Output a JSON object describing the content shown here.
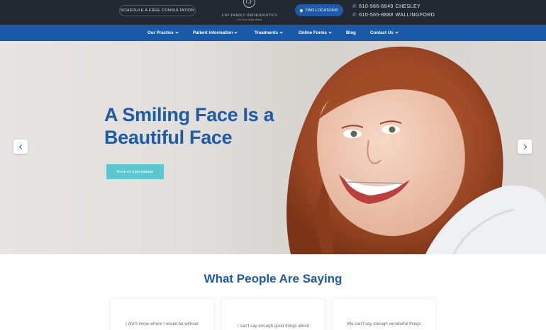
{
  "topbar": {
    "consult_label": "SCHEDULE A FREE CONSULTATION",
    "logo_mark": "CF",
    "logo_name": "CDF FAMILY ORTHODONTICS",
    "logo_tagline": "Let Your Smile Shine",
    "locations_label": "TWO LOCATIONS",
    "phones": [
      {
        "number": "610-566-6649",
        "location": "CHESLEY"
      },
      {
        "number": "610-565-8888",
        "location": "WALLINGFORD"
      }
    ]
  },
  "nav": {
    "items": [
      {
        "label": "Our Practice",
        "dropdown": true
      },
      {
        "label": "Patient information",
        "dropdown": true
      },
      {
        "label": "Treatments",
        "dropdown": true
      },
      {
        "label": "Online Forms",
        "dropdown": true
      },
      {
        "label": "Blog",
        "dropdown": false
      },
      {
        "label": "Contact Us",
        "dropdown": true
      }
    ]
  },
  "hero": {
    "title_line1": "A Smiling Face Is a",
    "title_line2": "Beautiful Face",
    "cta_label": "Book an Appointment",
    "prev_icon": "chevron-left-icon",
    "next_icon": "chevron-right-icon"
  },
  "testimonials": {
    "title": "What People Are Saying",
    "cards": [
      {
        "text": "I don't know where I would be without"
      },
      {
        "text": "I can't say enough good things about"
      },
      {
        "text": "We can't say enough wonderful things"
      }
    ]
  },
  "colors": {
    "topbar_bg": "#23272f",
    "nav_bg": "#1b5aa8",
    "brand_blue": "#1f5aa4",
    "cta_teal": "#5cc7cf"
  }
}
